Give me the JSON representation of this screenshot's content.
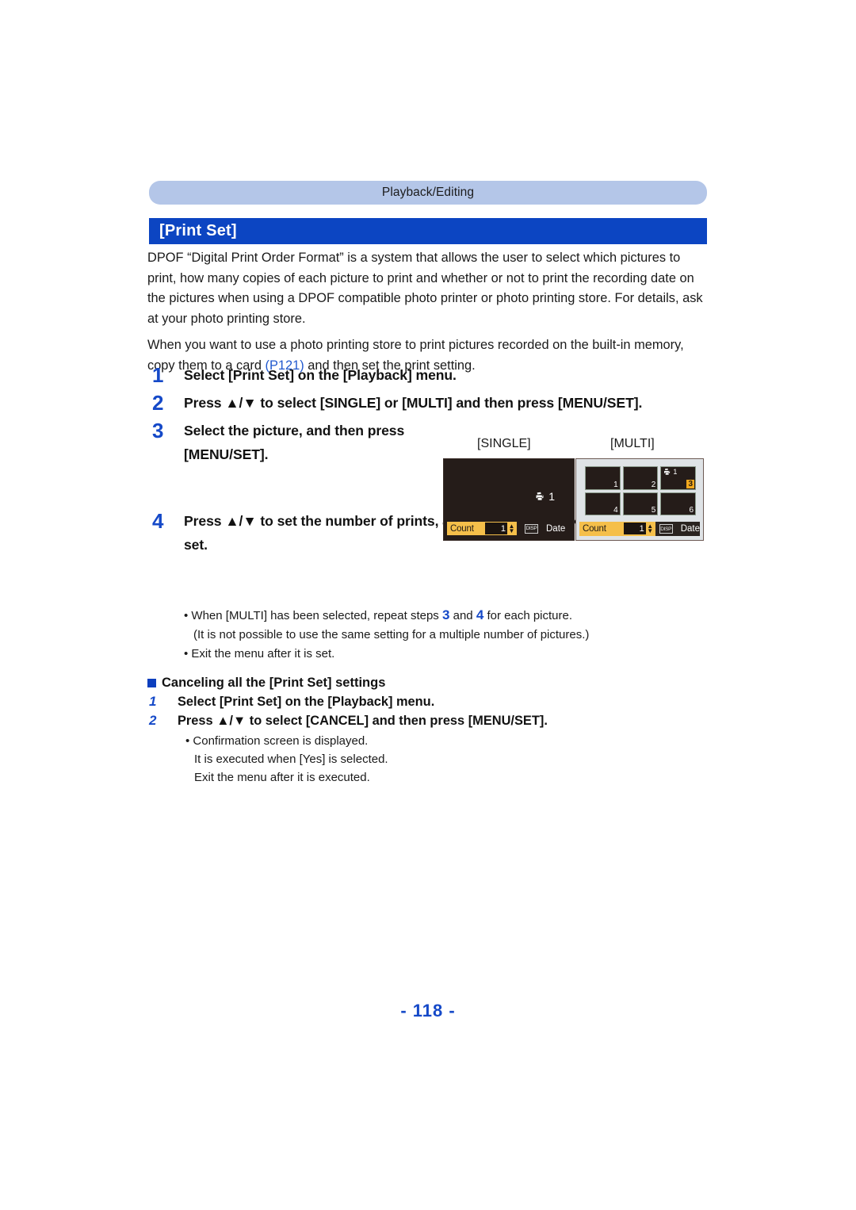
{
  "running_head": "Playback/Editing",
  "section_title": "[Print Set]",
  "intro": {
    "paragraph1": "DPOF “Digital Print Order Format” is a system that allows the user to select which pictures to print, how many copies of each picture to print and whether or not to print the recording date on the pictures when using a DPOF compatible photo printer or photo printing store. For details, ask at your photo printing store.",
    "paragraph2_before": "When you want to use a photo printing store to print pictures recorded on the built-in memory, copy them to a card ",
    "paragraph2_link": "(P121)",
    "paragraph2_after": " and then set the print setting."
  },
  "steps": [
    {
      "num": "1",
      "text": "Select [Print Set] on the [Playback] menu."
    },
    {
      "num": "2",
      "text": "Press ▲/▼ to select [SINGLE] or [MULTI] and then press [MENU/SET]."
    },
    {
      "num": "3",
      "line1": "Select the picture, and then press",
      "line2": "[MENU/SET]."
    },
    {
      "num": "4",
      "line1": "Press ▲/▼ to set the number of prints, and then press [MENU/SET] to",
      "line2": "set."
    }
  ],
  "figures": {
    "single_label": "[SINGLE]",
    "multi_label": "[MULTI]",
    "single_screen": {
      "print_icon": "printer-icon",
      "print_count": "1",
      "count_label": "Count",
      "count_value": "1",
      "disp_icon_text": "DISP",
      "date_label": "Date"
    },
    "multi_screen": {
      "cells": [
        {
          "num": "1",
          "highlighted": false,
          "badge": null
        },
        {
          "num": "2",
          "highlighted": false,
          "badge": null
        },
        {
          "num": "3",
          "highlighted": true,
          "badge": "1"
        },
        {
          "num": "4",
          "highlighted": false,
          "badge": null
        },
        {
          "num": "5",
          "highlighted": false,
          "badge": null
        },
        {
          "num": "6",
          "highlighted": false,
          "badge": null
        }
      ],
      "count_label": "Count",
      "count_value": "1",
      "disp_icon_text": "DISP",
      "date_label": "Date"
    }
  },
  "bullets": {
    "b1_before": "• When [MULTI] has been selected, repeat steps ",
    "b1_num_a": "3",
    "b1_mid": " and ",
    "b1_num_b": "4",
    "b1_after": " for each picture.",
    "b1_sub": "(It is not possible to use the same setting for a multiple number of pictures.)",
    "b2": "• Exit the menu after it is set."
  },
  "cancel_section": {
    "heading": "Canceling all the [Print Set] settings",
    "steps": [
      {
        "num": "1",
        "text": "Select [Print Set] on the [Playback] menu."
      },
      {
        "num": "2",
        "text": "Press ▲/▼ to select [CANCEL] and then press [MENU/SET]."
      }
    ],
    "notes": [
      "• Confirmation screen is displayed.",
      "It is executed when [Yes] is selected.",
      "Exit the menu after it is executed."
    ]
  },
  "page_number": "- 118 -",
  "colors": {
    "band": "#b4c6e8",
    "title_bar": "#0c45c2",
    "accent_blue": "#1549c8",
    "link_blue": "#2159cf",
    "screen_dark": "#251c19",
    "amber": "#f5bf4a",
    "highlight_orange": "#f2a81d"
  }
}
